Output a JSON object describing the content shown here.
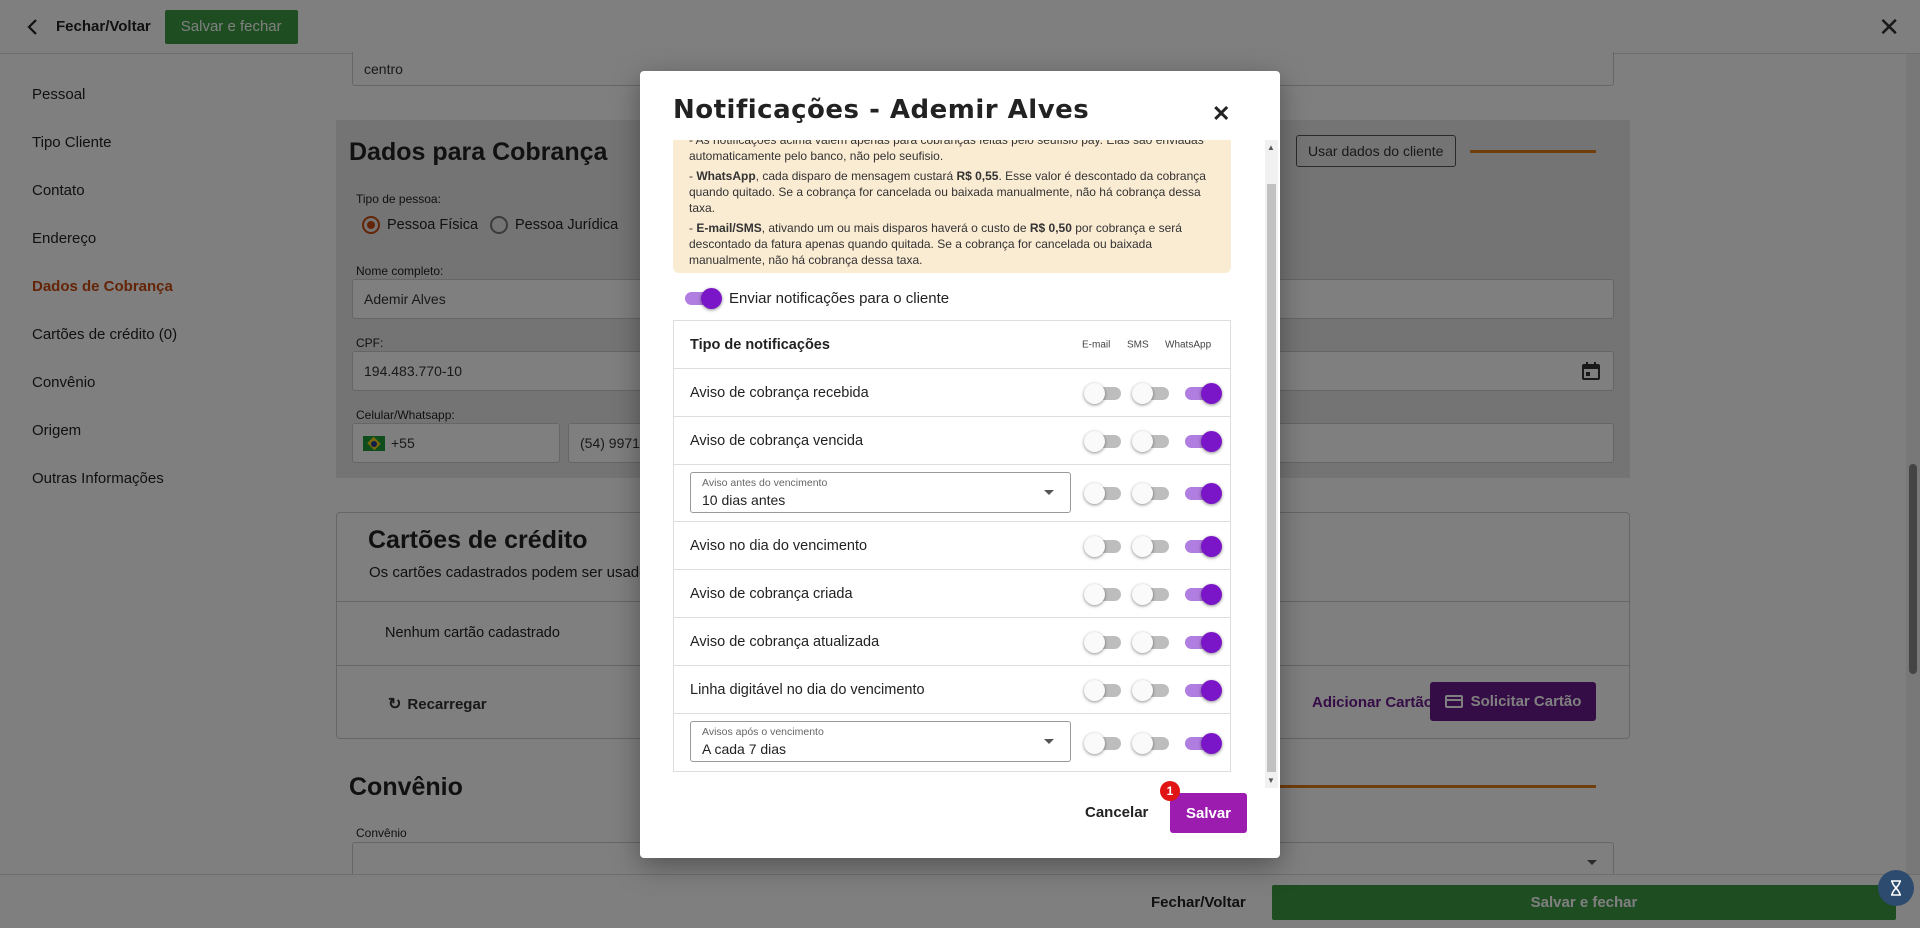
{
  "topbar": {
    "back_label": "Fechar/Voltar",
    "save_label": "Salvar e fechar",
    "close_icon": "✕"
  },
  "sidebar": {
    "items": [
      {
        "label": "Pessoal"
      },
      {
        "label": "Tipo Cliente"
      },
      {
        "label": "Contato"
      },
      {
        "label": "Endereço"
      },
      {
        "label": "Dados de Cobrança",
        "active": true
      },
      {
        "label": "Cartões de crédito (0)"
      },
      {
        "label": "Convênio"
      },
      {
        "label": "Origem"
      },
      {
        "label": "Outras Informações"
      }
    ]
  },
  "background": {
    "address_value": "centro",
    "billing": {
      "title": "Dados para Cobrança",
      "use_client_button": "Usar dados do cliente",
      "person_type_label": "Tipo de pessoa:",
      "option_fisica": "Pessoa Física",
      "option_juridica": "Pessoa Jurídica",
      "name_label": "Nome completo:",
      "name_value": "Ademir Alves",
      "cpf_label": "CPF:",
      "cpf_value": "194.483.770-10",
      "phone_label": "Celular/Whatsapp:",
      "phone_ddi": "+55",
      "phone_value": "(54) 9971"
    },
    "cards": {
      "title": "Cartões de crédito",
      "subtitle": "Os cartões cadastrados podem ser usado",
      "empty": "Nenhum cartão cadastrado",
      "reload": "Recarregar",
      "add_card": "Adicionar Cartão",
      "request_card": "Solicitar Cartão"
    },
    "convenio": {
      "title": "Convênio",
      "label": "Convênio"
    }
  },
  "bottombar": {
    "back_label": "Fechar/Voltar",
    "save_label": "Salvar e fechar"
  },
  "modal": {
    "title": "Notificações - Ademir Alves",
    "notice": {
      "line0": "- As notificações acima valem apenas para cobranças feitas pelo seufisio pay. Elas são enviadas automaticamente pelo banco, não pelo seufisio.",
      "p1_strong": "WhatsApp",
      "p1_a": ", cada disparo de mensagem custará ",
      "p1_price": "R$ 0,55",
      "p1_b": ". Esse valor é descontado da cobrança quando quitado. Se a cobrança for cancelada ou baixada manualmente, não há cobrança dessa taxa.",
      "p2_strong": "E-mail/SMS",
      "p2_a": ", ativando um ou mais disparos haverá o custo de ",
      "p2_price": "R$ 0,50",
      "p2_b": " por cobrança e será descontado da fatura apenas quando quitada. Se a cobrança for cancelada ou baixada manualmente, não há cobrança dessa taxa."
    },
    "send_label": "Enviar notificações para o cliente",
    "send_on": true,
    "table": {
      "header": "Tipo de notificações",
      "col_email": "E-mail",
      "col_sms": "SMS",
      "col_whatsapp": "WhatsApp",
      "rows": [
        {
          "label": "Aviso de cobrança recebida"
        },
        {
          "label": "Aviso de cobrança vencida"
        },
        {
          "select_label": "Aviso antes do vencimento",
          "select_value": "10 dias antes"
        },
        {
          "label": "Aviso no dia do vencimento"
        },
        {
          "label": "Aviso de cobrança criada"
        },
        {
          "label": "Aviso de cobrança atualizada"
        },
        {
          "label": "Linha digitável no dia do vencimento"
        },
        {
          "select_label": "Avisos após o vencimento",
          "select_value": "A cada 7 dias"
        }
      ]
    },
    "cancel_label": "Cancelar",
    "save_label": "Salvar",
    "badge_count": "1"
  }
}
